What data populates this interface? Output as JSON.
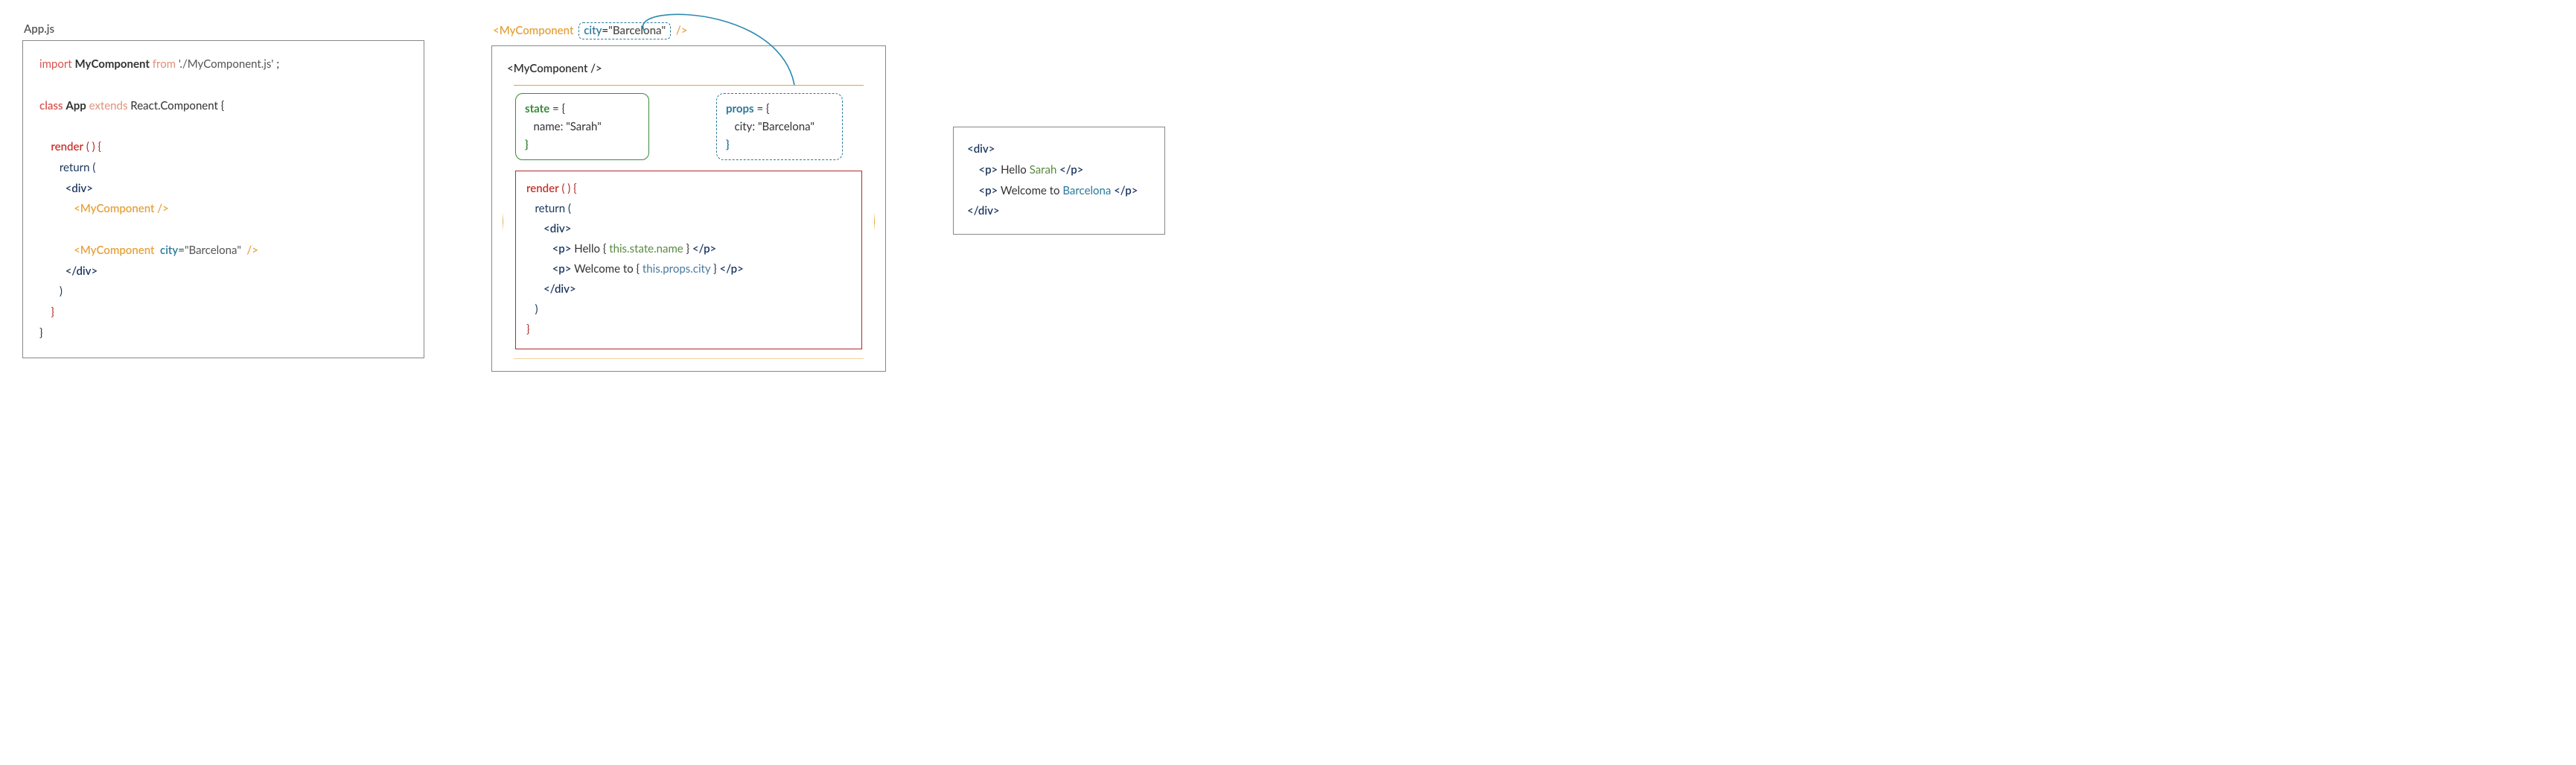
{
  "left": {
    "filename": "App.js",
    "line1_import": "import",
    "line1_comp": "MyComponent",
    "line1_from": "from",
    "line1_path": "'./MyComponent.js'",
    "line1_semi": " ;",
    "line2_class": "class",
    "line2_name": "App",
    "line2_extends": "extends",
    "line2_base": "React.Component {",
    "render": "render",
    "render_parens": " ( ) {",
    "return": "return (",
    "div_open": "<div>",
    "comp1": "<MyComponent />",
    "comp2_open": "<MyComponent  ",
    "comp2_attr": "city",
    "comp2_eq": "=",
    "comp2_val": "\"Barcelona\"",
    "comp2_close": "  />",
    "div_close": "</div>",
    "close_paren": ")",
    "close_brace1": "}",
    "close_brace2": "}"
  },
  "mid": {
    "header_open": "<MyComponent",
    "header_attr": "city",
    "header_eq": "=",
    "header_val": "\"Barcelona\"",
    "header_close": "/>",
    "inner_label": "<MyComponent />",
    "state_kw": "state",
    "state_eq": " = {",
    "state_line": "   name: \"Sarah\"",
    "state_close": "}",
    "props_kw": "props",
    "props_eq": " = {",
    "props_line": "   city: \"Barcelona\"",
    "props_close": "}",
    "render": "render",
    "render_parens": " ( ) {",
    "return": "return (",
    "div_open": "<div>",
    "p1_open": "<p>",
    "p1_text": " Hello { ",
    "p1_expr": "this.state.name",
    "p1_after": " } ",
    "p1_close": "</p>",
    "p2_open": "<p>",
    "p2_text": " Welcome to { ",
    "p2_expr": "this.props.city",
    "p2_after": " } ",
    "p2_close": "</p>",
    "div_close": "</div>",
    "close_paren": ")",
    "close_brace": "}"
  },
  "right": {
    "div_open": "<div>",
    "p1_open": "<p>",
    "p1_text": " Hello ",
    "p1_val": "Sarah",
    "p1_close": " </p>",
    "p2_open": "<p>",
    "p2_text": " Welcome to ",
    "p2_val": "Barcelona",
    "p2_close": " </p>",
    "div_close": "</div>"
  },
  "colors": {
    "orange": "#e6a23c",
    "red": "#b02a2a",
    "green": "#3a8a3a",
    "blue": "#2a7a9c",
    "navy": "#1a355e"
  }
}
